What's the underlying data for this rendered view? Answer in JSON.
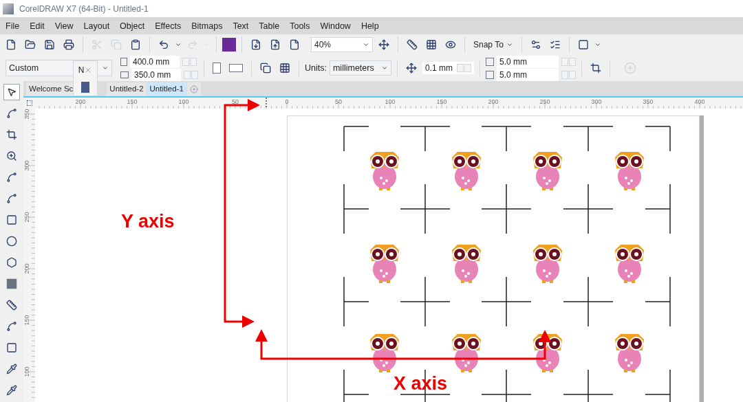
{
  "window": {
    "title": "CorelDRAW X7 (64-Bit) - Untitled-1"
  },
  "menu": [
    "File",
    "Edit",
    "View",
    "Layout",
    "Object",
    "Effects",
    "Bitmaps",
    "Text",
    "Table",
    "Tools",
    "Window",
    "Help"
  ],
  "toolbar": {
    "zoom": "40%",
    "snap": "Snap To"
  },
  "property_bar": {
    "preset": "Custom",
    "width": "400.0 mm",
    "height": "350.0 mm",
    "units_label": "Units:",
    "units": "millimeters",
    "nudge": "0.1 mm",
    "dup_x": "5.0 mm",
    "dup_y": "5.0 mm"
  },
  "popup": {
    "label": "N"
  },
  "tabs": [
    {
      "label": "Welcome Sc",
      "selected": false
    },
    {
      "label": "Untitled-2",
      "selected": false
    },
    {
      "label": "Untitled-1",
      "selected": true
    }
  ],
  "ruler_h": [
    "200",
    "150",
    "100",
    "50",
    "0",
    "50",
    "100",
    "150",
    "200",
    "250",
    "300",
    "350",
    "400"
  ],
  "ruler_v": [
    "350",
    "300",
    "250",
    "200",
    "150",
    "100"
  ],
  "annotations": {
    "y_axis": "Y axis",
    "x_axis": "X axis"
  }
}
